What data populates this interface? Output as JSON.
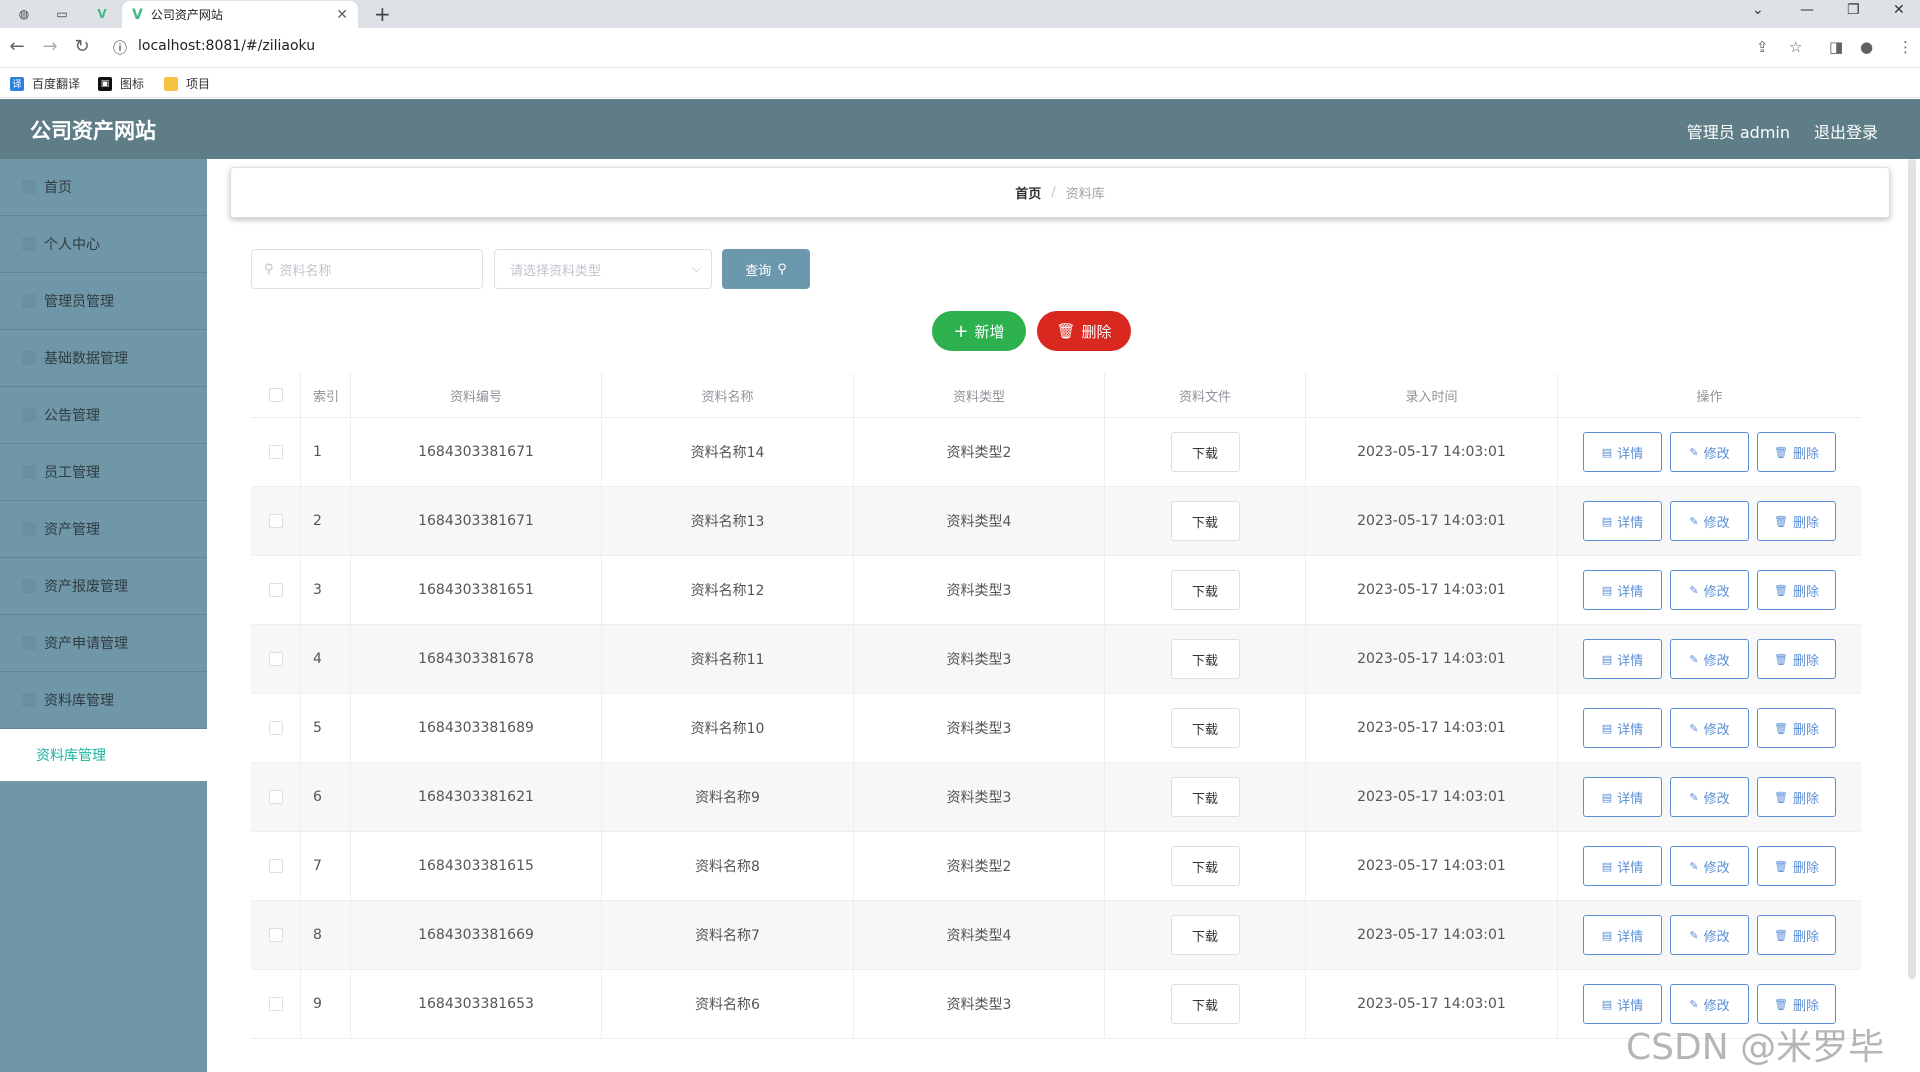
{
  "browser": {
    "tab_title": "公司资产网站",
    "url": "localhost:8081/#/ziliaoku",
    "bookmarks": [
      "百度翻译",
      "图标",
      "项目"
    ]
  },
  "header": {
    "title": "公司资产网站",
    "admin_label": "管理员 admin",
    "logout_label": "退出登录"
  },
  "sidebar": {
    "items": [
      "首页",
      "个人中心",
      "管理员管理",
      "基础数据管理",
      "公告管理",
      "员工管理",
      "资产管理",
      "资产报废管理",
      "资产申请管理",
      "资料库管理"
    ],
    "active_sub": "资料库管理"
  },
  "breadcrumb": {
    "home": "首页",
    "current": "资料库"
  },
  "search": {
    "name_placeholder": "资料名称",
    "type_placeholder": "请选择资料类型",
    "query_label": "查询"
  },
  "actions": {
    "add_label": "新增",
    "delete_label": "删除"
  },
  "table": {
    "headers": [
      "索引",
      "资料编号",
      "资料名称",
      "资料类型",
      "资料文件",
      "录入时间",
      "操作"
    ],
    "download_label": "下载",
    "detail_label": "详情",
    "edit_label": "修改",
    "delete_label": "删除",
    "rows": [
      {
        "idx": "1",
        "num": "1684303381671",
        "name": "资料名称14",
        "type": "资料类型2",
        "time": "2023-05-17 14:03:01"
      },
      {
        "idx": "2",
        "num": "1684303381671",
        "name": "资料名称13",
        "type": "资料类型4",
        "time": "2023-05-17 14:03:01"
      },
      {
        "idx": "3",
        "num": "1684303381651",
        "name": "资料名称12",
        "type": "资料类型3",
        "time": "2023-05-17 14:03:01"
      },
      {
        "idx": "4",
        "num": "1684303381678",
        "name": "资料名称11",
        "type": "资料类型3",
        "time": "2023-05-17 14:03:01"
      },
      {
        "idx": "5",
        "num": "1684303381689",
        "name": "资料名称10",
        "type": "资料类型3",
        "time": "2023-05-17 14:03:01"
      },
      {
        "idx": "6",
        "num": "1684303381621",
        "name": "资料名称9",
        "type": "资料类型3",
        "time": "2023-05-17 14:03:01"
      },
      {
        "idx": "7",
        "num": "1684303381615",
        "name": "资料名称8",
        "type": "资料类型2",
        "time": "2023-05-17 14:03:01"
      },
      {
        "idx": "8",
        "num": "1684303381669",
        "name": "资料名称7",
        "type": "资料类型4",
        "time": "2023-05-17 14:03:01"
      },
      {
        "idx": "9",
        "num": "1684303381653",
        "name": "资料名称6",
        "type": "资料类型3",
        "time": "2023-05-17 14:03:01"
      }
    ]
  },
  "watermark": "CSDN @米罗毕设",
  "colors": {
    "header_bg": "#5e7d87",
    "sidebar_bg": "#6f97a8",
    "active_sub": "#19b3a0",
    "add_btn": "#2db14e",
    "delete_btn": "#d9281f",
    "query_btn": "#6b98ac",
    "op_btn": "#5a8fd6"
  }
}
